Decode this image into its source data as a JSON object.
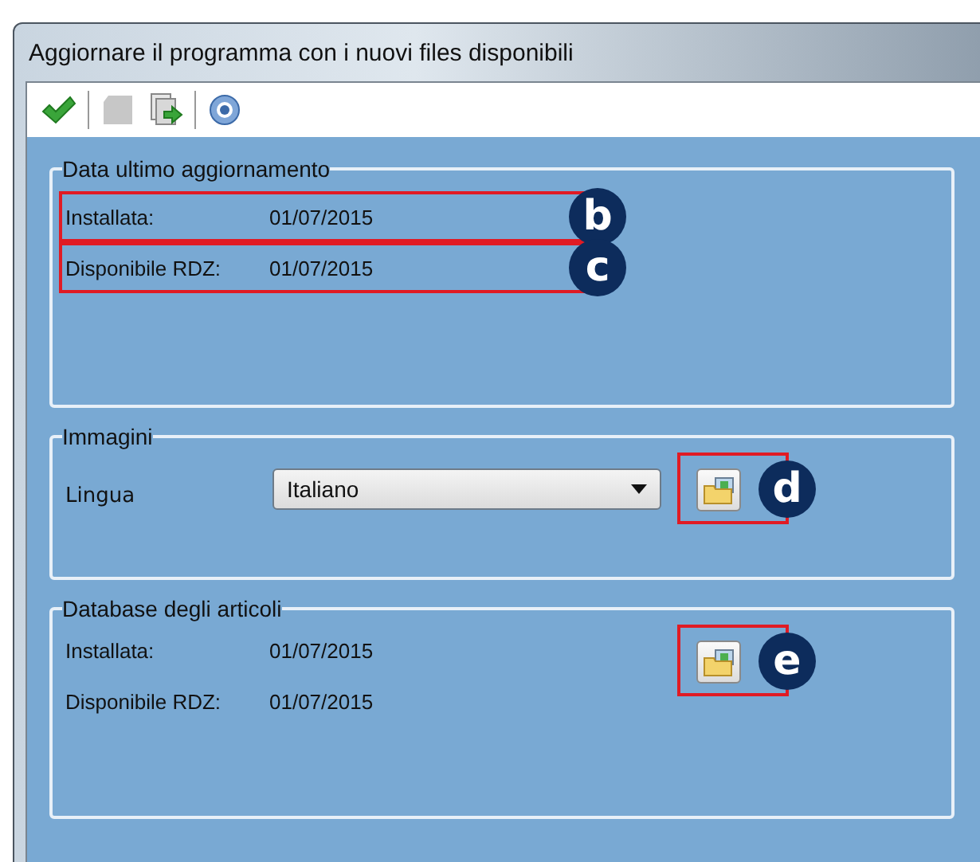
{
  "window": {
    "title": "Aggiornare il programma con i nuovi files disponibili"
  },
  "toolbar": [
    {
      "kind": "confirm",
      "disabled": false
    },
    {
      "kind": "separator"
    },
    {
      "kind": "blank",
      "disabled": true
    },
    {
      "kind": "export",
      "disabled": false
    },
    {
      "kind": "separator"
    },
    {
      "kind": "help",
      "disabled": false
    }
  ],
  "groups": [
    {
      "title": "Data ultimo aggiornamento",
      "rows": [
        {
          "label": "Installata:",
          "value": "01/07/2015",
          "callout": "b"
        },
        {
          "label": "Disponibile RDZ:",
          "value": "01/07/2015",
          "callout": "c"
        }
      ]
    },
    {
      "title": "Immagini",
      "dropdown": {
        "label": "Lingua",
        "value": "Italiano"
      },
      "button": {
        "callout": "d"
      }
    },
    {
      "title": "Database degli articoli",
      "rows": [
        {
          "label": "Installata:",
          "value": "01/07/2015"
        },
        {
          "label": "Disponibile RDZ:",
          "value": "01/07/2015"
        }
      ],
      "button": {
        "callout": "e"
      }
    }
  ]
}
